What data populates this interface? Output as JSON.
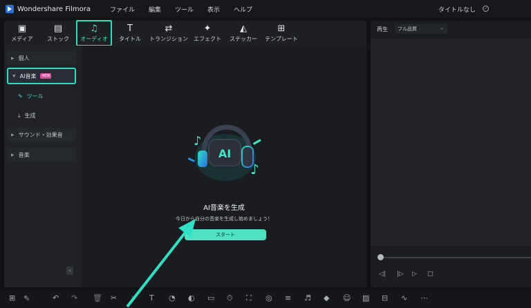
{
  "app": {
    "title": "Wondershare Filmora",
    "project_title": "タイトルなし"
  },
  "menu": [
    "ファイル",
    "編集",
    "ツール",
    "表示",
    "ヘルプ"
  ],
  "tabs": [
    {
      "label": "メディア",
      "icon": "media-icon"
    },
    {
      "label": "ストック",
      "icon": "stock-icon"
    },
    {
      "label": "オーディオ",
      "icon": "music-note-icon",
      "active": true
    },
    {
      "label": "タイトル",
      "icon": "title-t-icon"
    },
    {
      "label": "トランジション",
      "icon": "transition-icon"
    },
    {
      "label": "エフェクト",
      "icon": "effect-icon"
    },
    {
      "label": "ステッカー",
      "icon": "sticker-icon"
    },
    {
      "label": "テンプレート",
      "icon": "template-icon"
    }
  ],
  "sidebar": {
    "personal": "個人",
    "ai_music": "AI音楽",
    "badge": "NEW",
    "tool": "ツール",
    "generate": "生成",
    "sound_effects": "サウンド・効果音",
    "music": "音楽"
  },
  "content": {
    "heading": "AI音楽を生成",
    "subtext": "今日から自分の音楽を生成し始めましょう！",
    "start_button": "スタート",
    "illustration_label": "AI"
  },
  "preview": {
    "label": "再生",
    "quality": "フル品質"
  },
  "colors": {
    "accent": "#2fe0c4",
    "button": "#4fe0c4",
    "badge": "#d94ea3"
  }
}
